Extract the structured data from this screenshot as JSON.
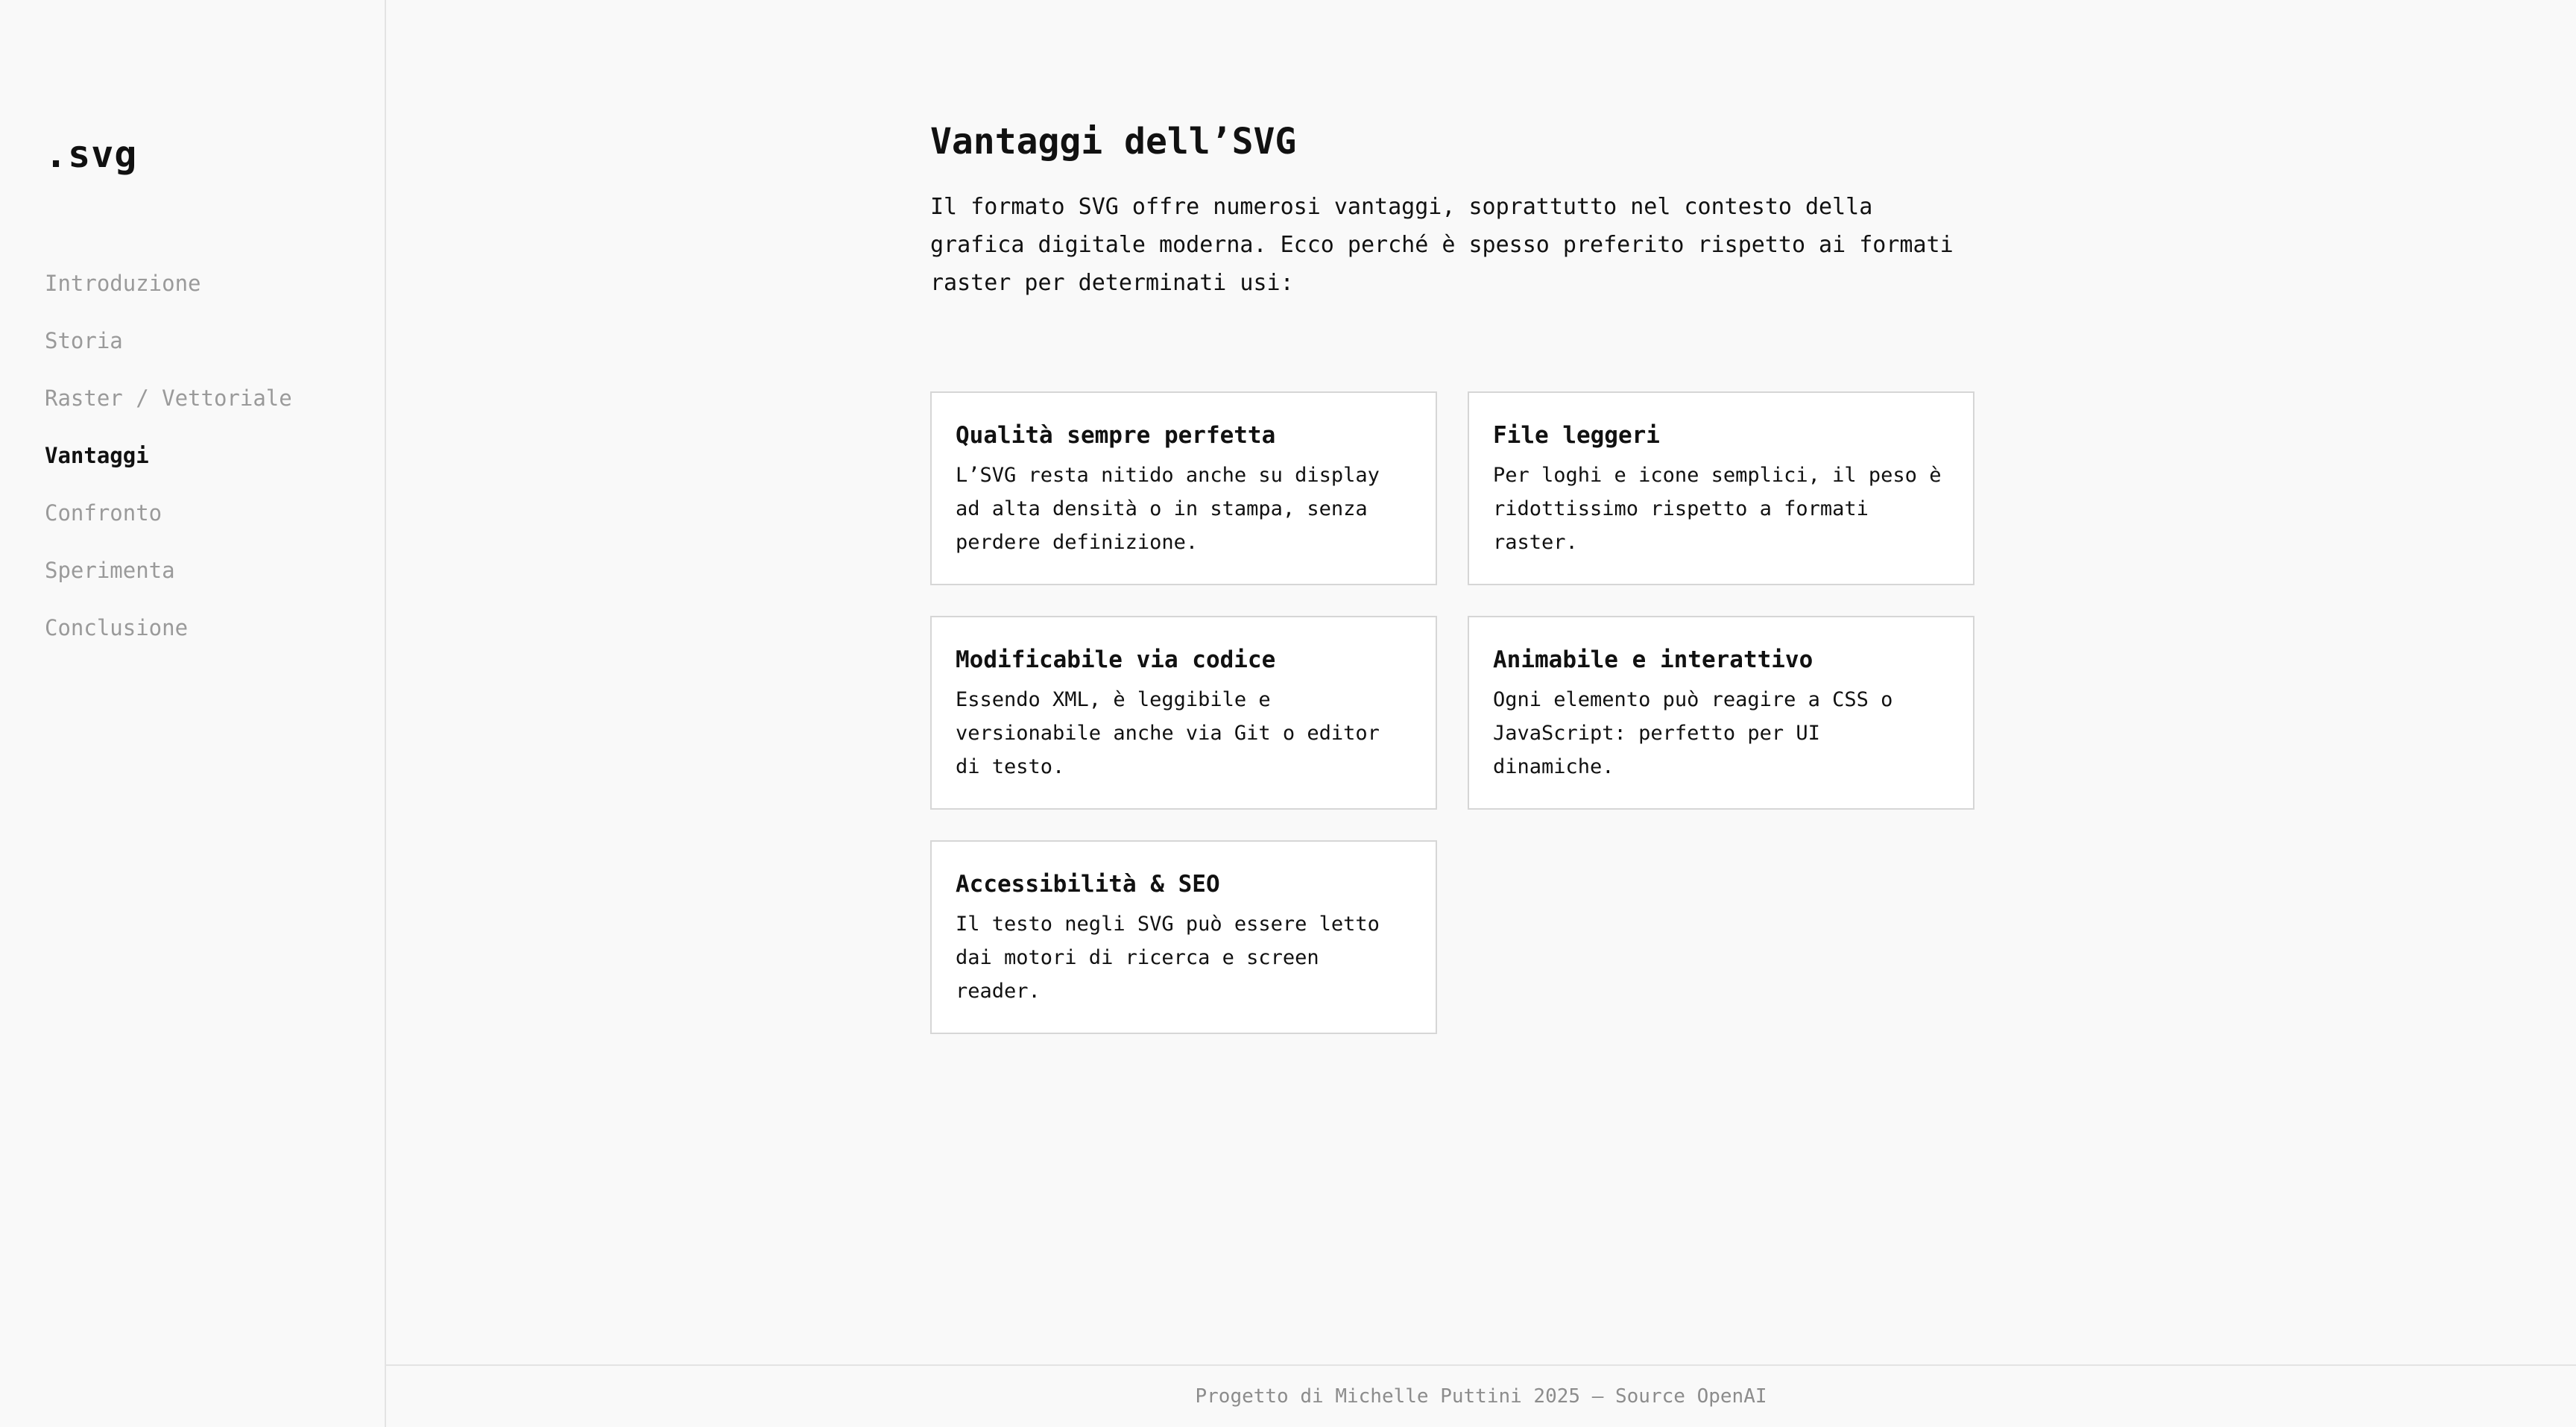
{
  "sidebar": {
    "brand": ".svg",
    "items": [
      {
        "label": "Introduzione",
        "active": false
      },
      {
        "label": "Storia",
        "active": false
      },
      {
        "label": "Raster / Vettoriale",
        "active": false
      },
      {
        "label": "Vantaggi",
        "active": true
      },
      {
        "label": "Confronto",
        "active": false
      },
      {
        "label": "Sperimenta",
        "active": false
      },
      {
        "label": "Conclusione",
        "active": false
      }
    ]
  },
  "main": {
    "title": "Vantaggi dell’SVG",
    "intro": "Il formato SVG offre numerosi vantaggi, soprattutto nel contesto della grafica digitale moderna. Ecco perché è spesso preferito rispetto ai formati raster per determinati usi:",
    "cards": [
      {
        "title": "Qualità sempre perfetta",
        "text": "L’SVG resta nitido anche su display ad alta densità o in stampa, senza perdere definizione."
      },
      {
        "title": "File leggeri",
        "text": "Per loghi e icone semplici, il peso è ridottissimo rispetto a formati raster."
      },
      {
        "title": "Modificabile via codice",
        "text": "Essendo XML, è leggibile e versionabile anche via Git o editor di testo."
      },
      {
        "title": "Animabile e interattivo",
        "text": "Ogni elemento può reagire a CSS o JavaScript: perfetto per UI dinamiche."
      },
      {
        "title": "Accessibilità & SEO",
        "text": "Il testo negli SVG può essere letto dai motori di ricerca e screen reader."
      }
    ]
  },
  "footer": {
    "text": "Progetto di Michelle Puttini 2025 — Source OpenAI"
  },
  "colors": {
    "background": "#f9f9f9",
    "card_background": "#ffffff",
    "border": "#d6d6d6",
    "text": "#111111",
    "muted_text": "#9a9a9a"
  }
}
